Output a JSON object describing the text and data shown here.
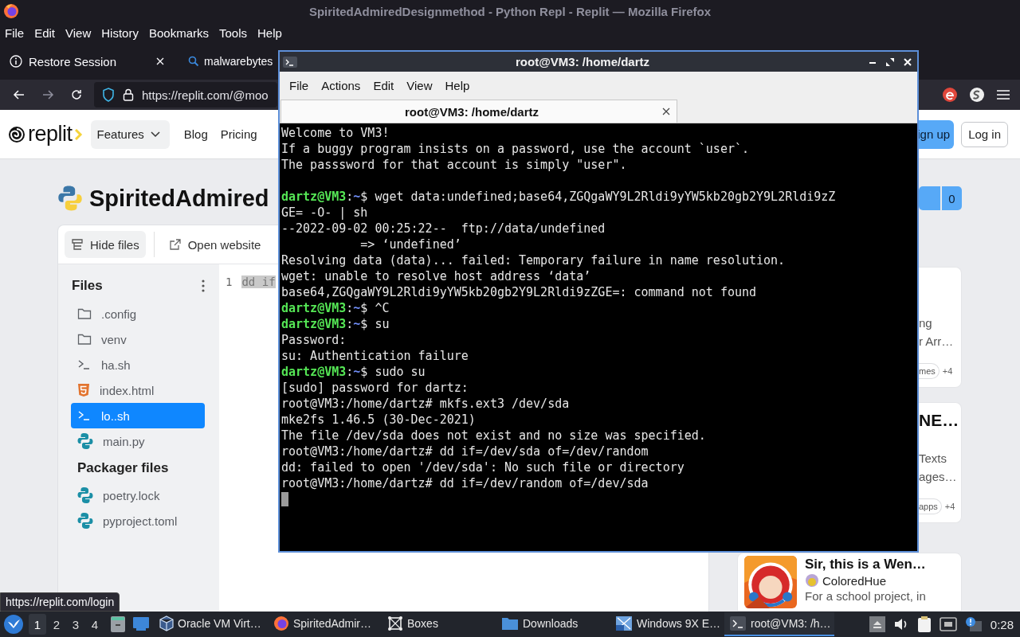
{
  "browser": {
    "title": "SpiritedAdmiredDesignmethod - Python Repl - Replit — Mozilla Firefox",
    "menu": [
      "File",
      "Edit",
      "View",
      "History",
      "Bookmarks",
      "Tools",
      "Help"
    ],
    "tabs": [
      {
        "label": "Restore Session",
        "kind": "info",
        "selected": false
      },
      {
        "label": "malwarebytes",
        "kind": "search",
        "selected": false
      }
    ],
    "url": "https://replit.com/@moo",
    "status_link": "https://replit.com/login"
  },
  "site": {
    "logo": "replit",
    "nav": [
      {
        "label": "Features",
        "kind": "dropdown"
      },
      {
        "label": "Blog",
        "kind": "link"
      },
      {
        "label": "Pricing",
        "kind": "link"
      }
    ],
    "signup": "ign up",
    "login": "Log in",
    "repl_title": "SpiritedAdmired",
    "like_count": "0",
    "toolbar": [
      {
        "label": "Hide files",
        "kind": "files"
      },
      {
        "label": "Open website",
        "kind": "external"
      }
    ],
    "files_heading": "Files",
    "files": [
      {
        "name": ".config",
        "kind": "folder",
        "selected": false
      },
      {
        "name": "venv",
        "kind": "folder",
        "selected": false
      },
      {
        "name": "ha.sh",
        "kind": "shell",
        "selected": false
      },
      {
        "name": "index.html",
        "kind": "html",
        "selected": false
      },
      {
        "name": "lo..sh",
        "kind": "shell",
        "selected": true
      },
      {
        "name": "main.py",
        "kind": "python",
        "selected": false
      }
    ],
    "packager_heading": "Packager files",
    "packager_files": [
      {
        "name": "poetry.lock",
        "kind": "python",
        "selected": false
      },
      {
        "name": "pyproject.toml",
        "kind": "python",
        "selected": false
      }
    ],
    "editor": {
      "line_number": "1",
      "code": "dd if"
    },
    "cards": [
      {
        "kind": "text",
        "lines": [
          "ng",
          "r Arr…"
        ],
        "tag": "mes",
        "more": "+4"
      },
      {
        "kind": "text",
        "title": "NE…",
        "lines": [
          "Texts",
          "ages…"
        ],
        "tag": "apps",
        "more": "+4"
      },
      {
        "kind": "picture",
        "title": "Sir, this is a Wen…",
        "author": "ColoredHue",
        "lines": [
          "For a school project, in"
        ]
      }
    ]
  },
  "terminal": {
    "title": "root@VM3: /home/dartz",
    "menu": [
      "File",
      "Actions",
      "Edit",
      "View",
      "Help"
    ],
    "tab": "root@VM3: /home/dartz",
    "lines": [
      {
        "kind": "output",
        "text": "Welcome to VM3!"
      },
      {
        "kind": "output",
        "text": "If a buggy program insists on a password, use the account `user`."
      },
      {
        "kind": "output",
        "text": "The passsword for that account is simply \"user\"."
      },
      {
        "kind": "blank"
      },
      {
        "kind": "prompt",
        "user": "dartz@VM3",
        "sep": ":",
        "path": "~",
        "command": "$ wget data:undefined;base64,ZGQgaWY9L2Rldi9yYW5kb20gb2Y9L2Rldi9zZ"
      },
      {
        "kind": "output",
        "text": "GE= -O- | sh"
      },
      {
        "kind": "output",
        "text": "--2022-09-02 00:25:22--  ftp://data/undefined"
      },
      {
        "kind": "output",
        "text": "           => ‘undefined’"
      },
      {
        "kind": "output",
        "text": "Resolving data (data)... failed: Temporary failure in name resolution."
      },
      {
        "kind": "output",
        "text": "wget: unable to resolve host address ‘data’"
      },
      {
        "kind": "output",
        "text": "base64,ZGQgaWY9L2Rldi9yYW5kb20gb2Y9L2Rldi9zZGE=: command not found"
      },
      {
        "kind": "prompt",
        "user": "dartz@VM3",
        "sep": ":",
        "path": "~",
        "command": "$ ^C"
      },
      {
        "kind": "prompt",
        "user": "dartz@VM3",
        "sep": ":",
        "path": "~",
        "command": "$ su"
      },
      {
        "kind": "output",
        "text": "Password:"
      },
      {
        "kind": "output",
        "text": "su: Authentication failure"
      },
      {
        "kind": "prompt",
        "user": "dartz@VM3",
        "sep": ":",
        "path": "~",
        "command": "$ sudo su"
      },
      {
        "kind": "output",
        "text": "[sudo] password for dartz:"
      },
      {
        "kind": "output",
        "text": "root@VM3:/home/dartz# mkfs.ext3 /dev/sda"
      },
      {
        "kind": "output",
        "text": "mke2fs 1.46.5 (30-Dec-2021)"
      },
      {
        "kind": "output",
        "text": "The file /dev/sda does not exist and no size was specified."
      },
      {
        "kind": "output",
        "text": "root@VM3:/home/dartz# dd if=/dev/sda of=/dev/random"
      },
      {
        "kind": "output",
        "text": "dd: failed to open '/dev/sda': No such file or directory"
      },
      {
        "kind": "output",
        "text": "root@VM3:/home/dartz# dd if=/dev/random of=/dev/sda"
      },
      {
        "kind": "cursor"
      }
    ]
  },
  "taskbar": {
    "workspaces": [
      {
        "label": "1",
        "selected": true
      },
      {
        "label": "2",
        "selected": false
      },
      {
        "label": "3",
        "selected": false
      },
      {
        "label": "4",
        "selected": false
      }
    ],
    "tasks": [
      {
        "label": "Oracle VM Virt…",
        "kind": "virtualbox",
        "selected": false
      },
      {
        "label": "SpiritedAdmir…",
        "kind": "firefox",
        "selected": false
      },
      {
        "label": "Boxes",
        "kind": "boxes",
        "selected": false
      },
      {
        "label": "Downloads",
        "kind": "folder",
        "selected": false
      },
      {
        "label": "Windows 9X E…",
        "kind": "vm",
        "selected": false
      },
      {
        "label": "root@VM3: /h…",
        "kind": "terminal",
        "selected": true
      }
    ],
    "clock": "0:28"
  }
}
